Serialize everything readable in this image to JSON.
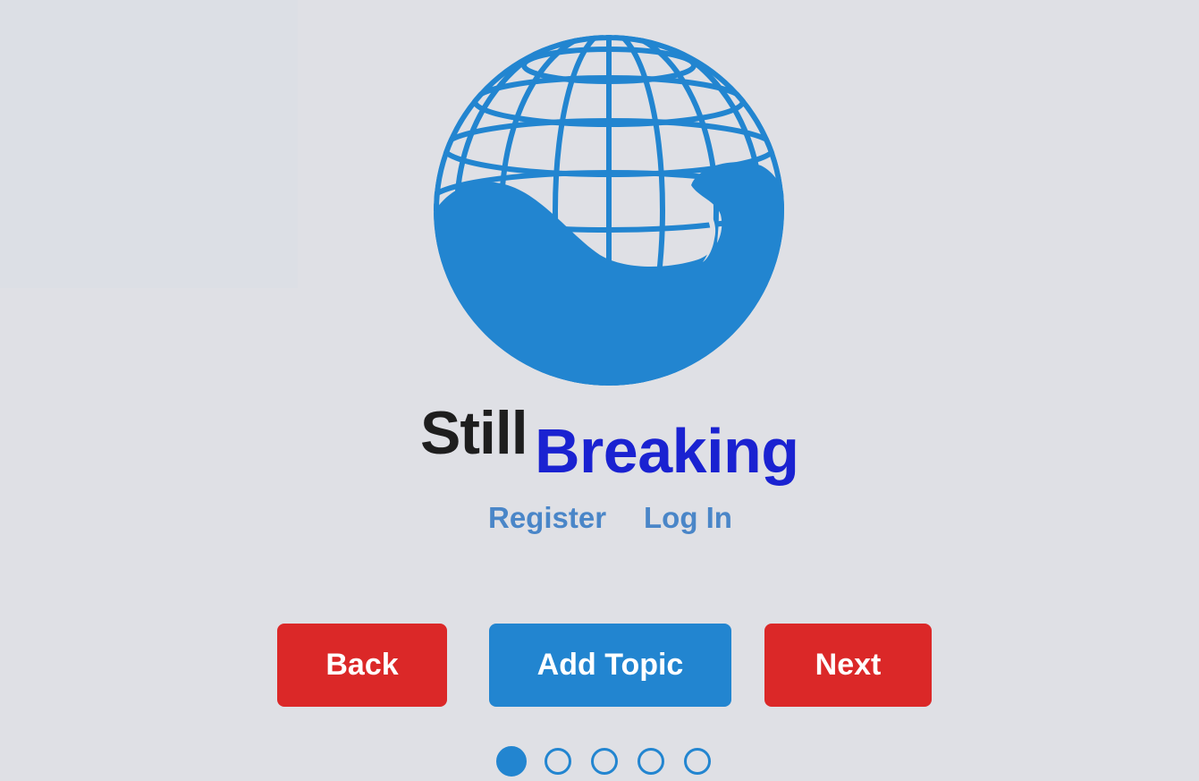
{
  "app": {
    "brand_part1": "Still",
    "brand_part2": "Breaking",
    "logo_icon": "globe-wave-icon",
    "colors": {
      "background": "#dfe0e5",
      "logo_blue": "#2285d0",
      "brand_dark": "#1e1e1e",
      "brand_blue": "#1a22d1",
      "link_blue": "#4a86c8",
      "button_red": "#db2828",
      "button_blue": "#2285d0"
    }
  },
  "auth": {
    "register_label": "Register",
    "login_label": "Log In"
  },
  "controls": {
    "back_label": "Back",
    "add_topic_label": "Add Topic",
    "next_label": "Next"
  },
  "pagination": {
    "total": 5,
    "current": 1
  }
}
